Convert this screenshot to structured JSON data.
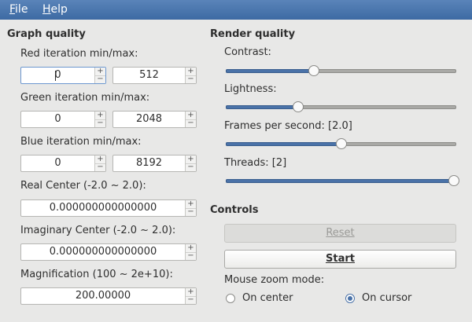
{
  "menu": {
    "file": "File",
    "help": "Help"
  },
  "graph_quality": {
    "title": "Graph quality",
    "red": {
      "label": "Red iteration min/max:",
      "min": "0",
      "max": "512"
    },
    "green": {
      "label": "Green iteration min/max:",
      "min": "0",
      "max": "2048"
    },
    "blue": {
      "label": "Blue iteration min/max:",
      "min": "0",
      "max": "8192"
    },
    "real_center": {
      "label": "Real Center (-2.0 ~ 2.0):",
      "value": "0.000000000000000"
    },
    "imag_center": {
      "label": "Imaginary Center (-2.0 ~ 2.0):",
      "value": "0.000000000000000"
    },
    "magnification": {
      "label": "Magnification (100 ~ 2e+10):",
      "value": "200.00000"
    }
  },
  "render_quality": {
    "title": "Render quality",
    "contrast": {
      "label": "Contrast:",
      "level": 0.38
    },
    "lightness": {
      "label": "Lightness:",
      "level": 0.31
    },
    "fps": {
      "label": "Frames per second: [2.0]",
      "level": 0.5
    },
    "threads": {
      "label": "Threads: [2]",
      "level": 1.0
    }
  },
  "controls": {
    "title": "Controls",
    "reset": "Reset",
    "start": "Start",
    "zoom_mode_label": "Mouse zoom mode:",
    "on_center": "On center",
    "on_cursor": "On cursor",
    "selected": "on_cursor"
  },
  "spin_up": "+",
  "spin_down": "−",
  "colors": {
    "menubar": "#4a76ad",
    "accent": "#4a72a8",
    "background": "#e8e8e7"
  }
}
